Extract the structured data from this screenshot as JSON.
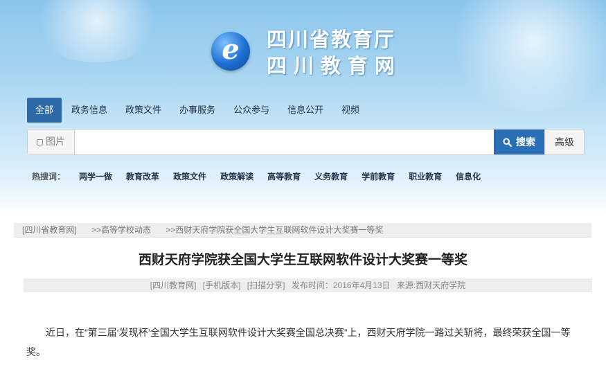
{
  "logo": {
    "mark": "e",
    "title": "四川省教育厅",
    "subtitle": "四川教育网"
  },
  "tabs": [
    {
      "label": "全部",
      "active": true
    },
    {
      "label": "政务信息"
    },
    {
      "label": "政策文件"
    },
    {
      "label": "办事服务"
    },
    {
      "label": "公众参与"
    },
    {
      "label": "信息公开"
    },
    {
      "label": "视频"
    }
  ],
  "search": {
    "image_option": "图片",
    "placeholder": "",
    "value": "",
    "button_label": "搜索",
    "advanced_label": "高级"
  },
  "hot_search": {
    "label": "热搜词：",
    "items": [
      "两学一做",
      "教育改革",
      "政策文件",
      "政策解读",
      "高等教育",
      "义务教育",
      "学前教育",
      "职业教育",
      "信息化"
    ]
  },
  "breadcrumb": [
    "[四川省教育网]",
    ">>高等学校动态",
    ">>西财天府学院获全国大学生互联网软件设计大奖赛一等奖"
  ],
  "article": {
    "title": "西财天府学院获全国大学生互联网软件设计大奖赛一等奖",
    "meta": {
      "source_site": "[四川教育网]",
      "mobile": "[手机版本]",
      "scan_share": "[扫描分享]",
      "publish_time": "发布时间：2016年4月13日",
      "origin": "来源:西财天府学院"
    },
    "body": "近日，在“第三届‘发现杯’全国大学生互联网软件设计大奖赛全国总决赛”上，西财天府学院一路过关斩将，最终荣获全国一等奖。"
  },
  "colors": {
    "accent": "#2d6aa6",
    "search_button": "#2a6fb5"
  }
}
